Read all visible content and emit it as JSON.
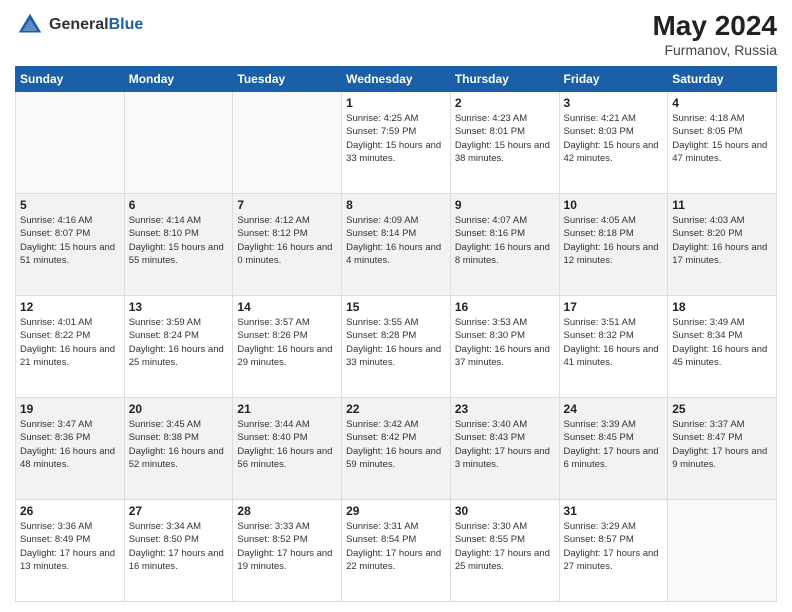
{
  "header": {
    "logo_general": "General",
    "logo_blue": "Blue",
    "main_title": "May 2024",
    "sub_title": "Furmanov, Russia"
  },
  "weekdays": [
    "Sunday",
    "Monday",
    "Tuesday",
    "Wednesday",
    "Thursday",
    "Friday",
    "Saturday"
  ],
  "weeks": [
    [
      {
        "day": "",
        "info": ""
      },
      {
        "day": "",
        "info": ""
      },
      {
        "day": "",
        "info": ""
      },
      {
        "day": "1",
        "info": "Sunrise: 4:25 AM\nSunset: 7:59 PM\nDaylight: 15 hours\nand 33 minutes."
      },
      {
        "day": "2",
        "info": "Sunrise: 4:23 AM\nSunset: 8:01 PM\nDaylight: 15 hours\nand 38 minutes."
      },
      {
        "day": "3",
        "info": "Sunrise: 4:21 AM\nSunset: 8:03 PM\nDaylight: 15 hours\nand 42 minutes."
      },
      {
        "day": "4",
        "info": "Sunrise: 4:18 AM\nSunset: 8:05 PM\nDaylight: 15 hours\nand 47 minutes."
      }
    ],
    [
      {
        "day": "5",
        "info": "Sunrise: 4:16 AM\nSunset: 8:07 PM\nDaylight: 15 hours\nand 51 minutes."
      },
      {
        "day": "6",
        "info": "Sunrise: 4:14 AM\nSunset: 8:10 PM\nDaylight: 15 hours\nand 55 minutes."
      },
      {
        "day": "7",
        "info": "Sunrise: 4:12 AM\nSunset: 8:12 PM\nDaylight: 16 hours\nand 0 minutes."
      },
      {
        "day": "8",
        "info": "Sunrise: 4:09 AM\nSunset: 8:14 PM\nDaylight: 16 hours\nand 4 minutes."
      },
      {
        "day": "9",
        "info": "Sunrise: 4:07 AM\nSunset: 8:16 PM\nDaylight: 16 hours\nand 8 minutes."
      },
      {
        "day": "10",
        "info": "Sunrise: 4:05 AM\nSunset: 8:18 PM\nDaylight: 16 hours\nand 12 minutes."
      },
      {
        "day": "11",
        "info": "Sunrise: 4:03 AM\nSunset: 8:20 PM\nDaylight: 16 hours\nand 17 minutes."
      }
    ],
    [
      {
        "day": "12",
        "info": "Sunrise: 4:01 AM\nSunset: 8:22 PM\nDaylight: 16 hours\nand 21 minutes."
      },
      {
        "day": "13",
        "info": "Sunrise: 3:59 AM\nSunset: 8:24 PM\nDaylight: 16 hours\nand 25 minutes."
      },
      {
        "day": "14",
        "info": "Sunrise: 3:57 AM\nSunset: 8:26 PM\nDaylight: 16 hours\nand 29 minutes."
      },
      {
        "day": "15",
        "info": "Sunrise: 3:55 AM\nSunset: 8:28 PM\nDaylight: 16 hours\nand 33 minutes."
      },
      {
        "day": "16",
        "info": "Sunrise: 3:53 AM\nSunset: 8:30 PM\nDaylight: 16 hours\nand 37 minutes."
      },
      {
        "day": "17",
        "info": "Sunrise: 3:51 AM\nSunset: 8:32 PM\nDaylight: 16 hours\nand 41 minutes."
      },
      {
        "day": "18",
        "info": "Sunrise: 3:49 AM\nSunset: 8:34 PM\nDaylight: 16 hours\nand 45 minutes."
      }
    ],
    [
      {
        "day": "19",
        "info": "Sunrise: 3:47 AM\nSunset: 8:36 PM\nDaylight: 16 hours\nand 48 minutes."
      },
      {
        "day": "20",
        "info": "Sunrise: 3:45 AM\nSunset: 8:38 PM\nDaylight: 16 hours\nand 52 minutes."
      },
      {
        "day": "21",
        "info": "Sunrise: 3:44 AM\nSunset: 8:40 PM\nDaylight: 16 hours\nand 56 minutes."
      },
      {
        "day": "22",
        "info": "Sunrise: 3:42 AM\nSunset: 8:42 PM\nDaylight: 16 hours\nand 59 minutes."
      },
      {
        "day": "23",
        "info": "Sunrise: 3:40 AM\nSunset: 8:43 PM\nDaylight: 17 hours\nand 3 minutes."
      },
      {
        "day": "24",
        "info": "Sunrise: 3:39 AM\nSunset: 8:45 PM\nDaylight: 17 hours\nand 6 minutes."
      },
      {
        "day": "25",
        "info": "Sunrise: 3:37 AM\nSunset: 8:47 PM\nDaylight: 17 hours\nand 9 minutes."
      }
    ],
    [
      {
        "day": "26",
        "info": "Sunrise: 3:36 AM\nSunset: 8:49 PM\nDaylight: 17 hours\nand 13 minutes."
      },
      {
        "day": "27",
        "info": "Sunrise: 3:34 AM\nSunset: 8:50 PM\nDaylight: 17 hours\nand 16 minutes."
      },
      {
        "day": "28",
        "info": "Sunrise: 3:33 AM\nSunset: 8:52 PM\nDaylight: 17 hours\nand 19 minutes."
      },
      {
        "day": "29",
        "info": "Sunrise: 3:31 AM\nSunset: 8:54 PM\nDaylight: 17 hours\nand 22 minutes."
      },
      {
        "day": "30",
        "info": "Sunrise: 3:30 AM\nSunset: 8:55 PM\nDaylight: 17 hours\nand 25 minutes."
      },
      {
        "day": "31",
        "info": "Sunrise: 3:29 AM\nSunset: 8:57 PM\nDaylight: 17 hours\nand 27 minutes."
      },
      {
        "day": "",
        "info": ""
      }
    ]
  ]
}
